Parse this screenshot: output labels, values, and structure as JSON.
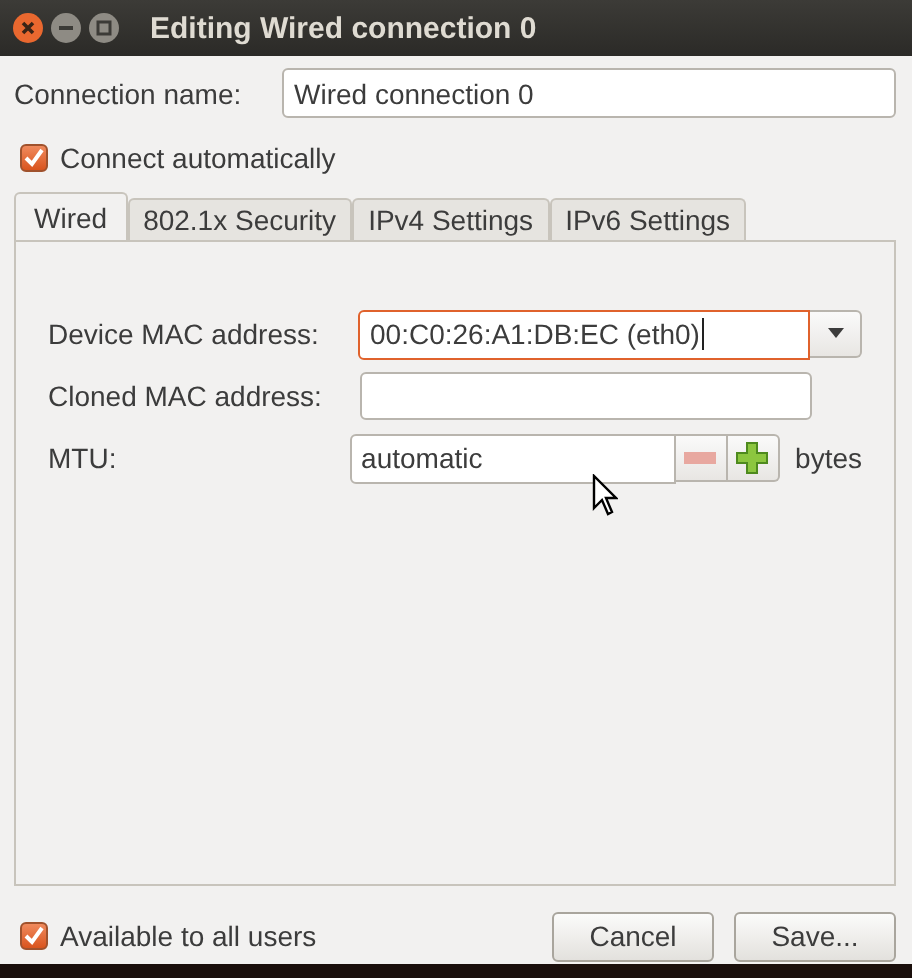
{
  "window": {
    "title": "Editing Wired connection 0"
  },
  "connection_name": {
    "label": "Connection name:",
    "value": "Wired connection 0"
  },
  "connect_automatically": {
    "label": "Connect automatically",
    "checked": true
  },
  "tabs": [
    {
      "label": "Wired",
      "selected": true
    },
    {
      "label": "802.1x Security",
      "selected": false
    },
    {
      "label": "IPv4 Settings",
      "selected": false
    },
    {
      "label": "IPv6 Settings",
      "selected": false
    }
  ],
  "fields": [
    {
      "kind": "combo",
      "label": "Device MAC address:",
      "value": "00:C0:26:A1:DB:EC (eth0)",
      "focused": true
    },
    {
      "kind": "entry",
      "label": "Cloned MAC address:",
      "focused": false
    },
    {
      "kind": "spin",
      "label": "MTU:",
      "value": "automatic",
      "unit": "bytes",
      "focused": false,
      "minus_disabled": true
    }
  ],
  "available_to_all_users": {
    "label": "Available to all users",
    "checked": true
  },
  "buttons": [
    {
      "label": "Cancel"
    },
    {
      "label": "Save..."
    }
  ]
}
